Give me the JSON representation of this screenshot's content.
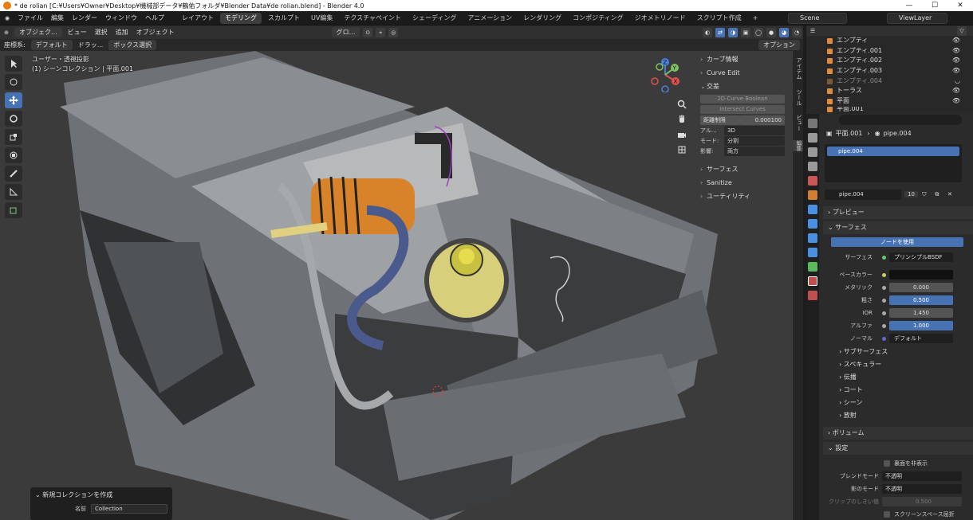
{
  "window": {
    "title": "* de rolian [C:¥Users¥Owner¥Desktop¥機械部データ¥鶴佑フォルダ¥Blender Data¥de rolian.blend] - Blender 4.0",
    "controls": [
      "—",
      "☐",
      "✕"
    ]
  },
  "menu": {
    "items": [
      "ファイル",
      "編集",
      "レンダー",
      "ウィンドウ",
      "ヘルプ"
    ],
    "workspaces": [
      "レイアウト",
      "モデリング",
      "スカルプト",
      "UV編集",
      "テクスチャペイント",
      "シェーディング",
      "アニメーション",
      "レンダリング",
      "コンポジティング",
      "ジオメトリノード",
      "スクリプト作成",
      "+"
    ],
    "active_workspace": "モデリング",
    "scene": "Scene",
    "view_layer": "ViewLayer"
  },
  "viewport_header": {
    "mode": "オブジェク...",
    "menus": [
      "ビュー",
      "選択",
      "追加",
      "オブジェクト"
    ],
    "transform": "グロ...",
    "coord_label": "座標系:",
    "coord_value": "デフォルト",
    "drag_label": "ドラッ...",
    "select_mode": "ボックス選択",
    "options": "オプション"
  },
  "viewport": {
    "view_name": "ユーザー・透視投影",
    "collection_info": "(1) シーンコレクション | 平面.001"
  },
  "gizmo": {
    "x": "X",
    "y": "Y",
    "z": "Z"
  },
  "n_panel": {
    "sections": [
      "カーブ情報",
      "Curve Edit",
      "交差"
    ],
    "buttons": [
      "2D Curve Boolean",
      "Intersect Curves"
    ],
    "distance_label": "距離制限",
    "distance_value": "0.000100",
    "fields": [
      {
        "label": "アル...",
        "value": "3D"
      },
      {
        "label": "モード:",
        "value": "分割"
      },
      {
        "label": "影響:",
        "value": "両方"
      }
    ],
    "sections_after": [
      "サーフェス",
      "Sanitize",
      "ユーティリティ"
    ]
  },
  "side_tabs": [
    "アイテム",
    "ツール",
    "ビュー",
    "編集"
  ],
  "operator_panel": {
    "title": "新規コレクションを作成",
    "name_label": "名前",
    "name_value": "Collection"
  },
  "outliner": {
    "rows": [
      {
        "name": "エンプティ",
        "color": "#e08a3c"
      },
      {
        "name": "エンプティ.001",
        "color": "#e08a3c"
      },
      {
        "name": "エンプティ.002",
        "color": "#e08a3c"
      },
      {
        "name": "エンプティ.003",
        "color": "#e08a3c"
      },
      {
        "name": "エンプティ.004",
        "color": "#7a5a3a"
      },
      {
        "name": "トーラス",
        "color": "#e08a3c"
      },
      {
        "name": "平面",
        "color": "#e08a3c"
      },
      {
        "name": "平面.001",
        "color": "#e08a3c"
      }
    ]
  },
  "properties": {
    "breadcrumb_object": "平面.001",
    "breadcrumb_material": "pipe.004",
    "slot_name": "pipe.004",
    "material_name": "pipe.004",
    "user_count": "10",
    "sections": {
      "preview": "プレビュー",
      "surface": "サーフェス",
      "volume": "ボリューム",
      "settings": "設定"
    },
    "use_nodes": "ノードを使用",
    "surface_label": "サーフェス",
    "surface_value": "プリンシプルBSDF",
    "fields": [
      {
        "label": "ベースカラー",
        "value": ""
      },
      {
        "label": "メタリック",
        "value": "0.000"
      },
      {
        "label": "粗さ",
        "value": "0.500"
      },
      {
        "label": "IOR",
        "value": "1.450"
      },
      {
        "label": "アルファ",
        "value": "1.000"
      },
      {
        "label": "ノーマル",
        "value": "デフォルト"
      }
    ],
    "subsections": [
      "サブサーフェス",
      "スペキュラー",
      "伝播",
      "コート",
      "シーン",
      "放射"
    ],
    "backface_label": "裏面を非表示",
    "blend_mode_label": "ブレンドモード",
    "blend_mode_value": "不透明",
    "shadow_mode_label": "影のモード",
    "shadow_mode_value": "不透明",
    "clip_label": "クリップのしきい値",
    "clip_value": "0.500",
    "screen_refraction_label": "スクリーンスペース屈折"
  }
}
